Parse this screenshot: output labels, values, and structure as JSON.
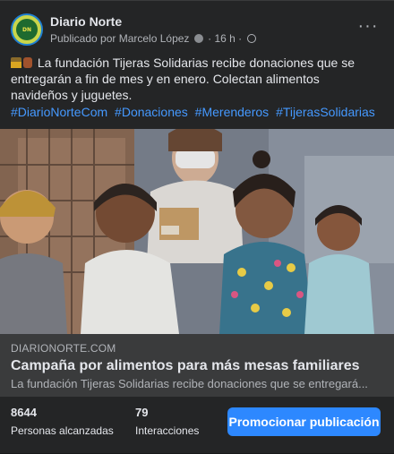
{
  "post": {
    "page_name": "Diario Norte",
    "published_by": "Publicado por Marcelo López",
    "time": "16 h",
    "caption": "La fundación Tijeras Solidarias recibe donaciones que se entregarán a fin de mes y en enero. Colectan alimentos navideños y juguetes.",
    "hashtags": [
      "#DiarioNorteCom",
      "#Donaciones",
      "#Merenderos",
      "#TijerasSolidarias"
    ],
    "avatar_text": "DIARIO NORTE"
  },
  "link": {
    "domain": "DIARIONORTE.COM",
    "title": "Campaña por alimentos para más mesas familiares",
    "description": "La fundación Tijeras Solidarias recibe donaciones que se entregará..."
  },
  "insights": {
    "reach_value": "8644",
    "reach_label": "Personas alcanzadas",
    "interactions_value": "79",
    "interactions_label": "Interacciones",
    "promote_label": "Promocionar publicación"
  },
  "colors": {
    "card_bg": "#242526",
    "link_card_bg": "#3a3b3c",
    "hashtag": "#4599ff",
    "button": "#2d88ff"
  },
  "icons": [
    "page-avatar",
    "verified-badge-icon",
    "globe-icon",
    "more-options-icon",
    "graduation-cap-icon",
    "hat-icon"
  ]
}
